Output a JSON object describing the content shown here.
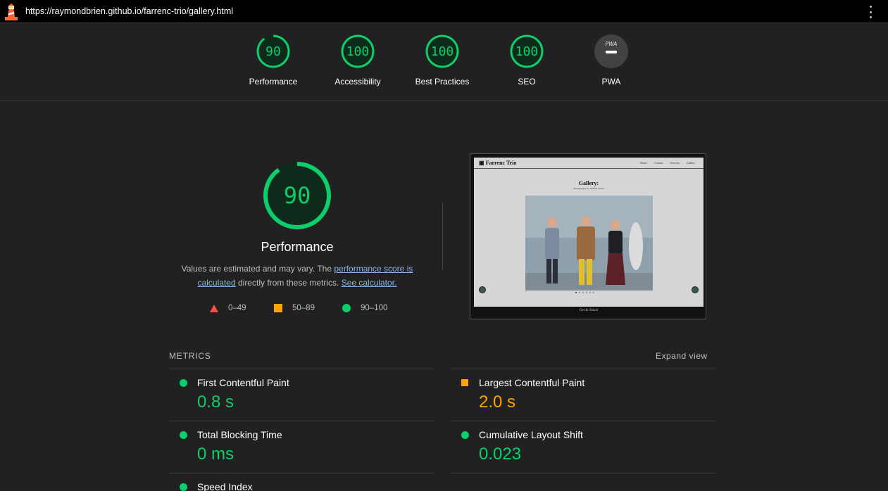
{
  "browser": {
    "url": "https://raymondbrien.github.io/farrenc-trio/gallery.html"
  },
  "gauges": [
    {
      "label": "Performance",
      "score": "90",
      "fraction": 0.9
    },
    {
      "label": "Accessibility",
      "score": "100",
      "fraction": 1.0
    },
    {
      "label": "Best Practices",
      "score": "100",
      "fraction": 1.0
    },
    {
      "label": "SEO",
      "score": "100",
      "fraction": 1.0
    },
    {
      "label": "PWA",
      "score": "PWA"
    }
  ],
  "performance": {
    "score": "90",
    "fraction": 0.9,
    "title": "Performance",
    "desc_prefix": "Values are estimated and may vary. The ",
    "link_score": "performance score is calculated",
    "desc_mid": " directly from these metrics. ",
    "link_calc": "See calculator."
  },
  "legend": {
    "fail": "0–49",
    "average": "50–89",
    "pass": "90–100"
  },
  "colors": {
    "pass": "#0cce6b",
    "average": "#ffa400",
    "fail": "#ff4e42"
  },
  "preview": {
    "brand": "Farrenc Trio",
    "nav": [
      "Home",
      "Contact",
      "Services",
      "Gallery"
    ],
    "heading": "Gallery:",
    "subheading": "Photography by Stefana Godio",
    "footer": "Get In Touch"
  },
  "metrics": {
    "title": "METRICS",
    "expand_label": "Expand view",
    "items": [
      {
        "name": "First Contentful Paint",
        "value": "0.8 s",
        "status": "pass"
      },
      {
        "name": "Largest Contentful Paint",
        "value": "2.0 s",
        "status": "average"
      },
      {
        "name": "Total Blocking Time",
        "value": "0 ms",
        "status": "pass"
      },
      {
        "name": "Cumulative Layout Shift",
        "value": "0.023",
        "status": "pass"
      },
      {
        "name": "Speed Index",
        "value": "",
        "status": "pass"
      }
    ]
  }
}
